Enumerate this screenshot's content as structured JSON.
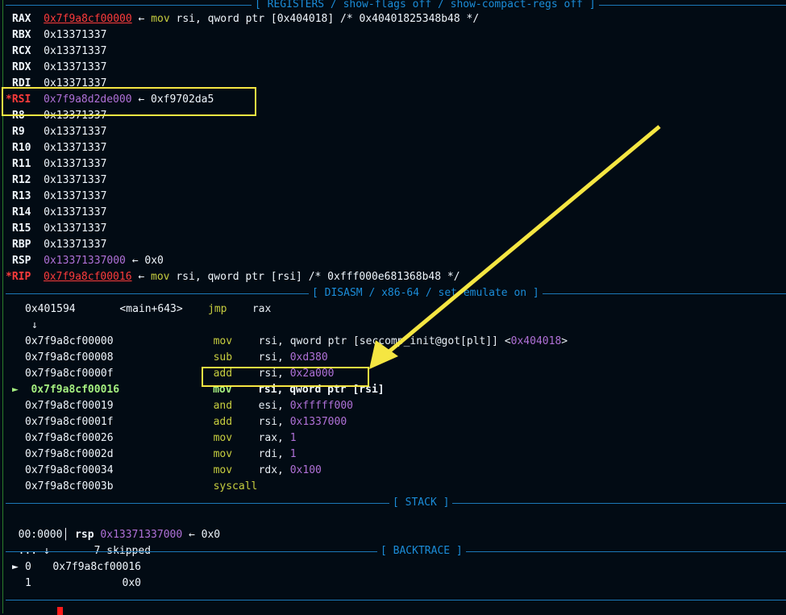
{
  "headers": {
    "registers": "[ REGISTERS / show-flags off / show-compact-regs off ]",
    "disasm": "[ DISASM / x86-64 / set emulate on ]",
    "stack": "[ STACK ]",
    "backtrace": "[ BACKTRACE ]"
  },
  "registers": [
    {
      "name": "RAX",
      "modified": false,
      "value": "0x7f9a8cf00000",
      "value_kind": "red-ptr",
      "deref": "mov rsi, qword ptr [0x404018] /* 0x40401825348b48 */"
    },
    {
      "name": "RBX",
      "modified": false,
      "value": "0x13371337"
    },
    {
      "name": "RCX",
      "modified": false,
      "value": "0x13371337"
    },
    {
      "name": "RDX",
      "modified": false,
      "value": "0x13371337"
    },
    {
      "name": "RDI",
      "modified": false,
      "value": "0x13371337"
    },
    {
      "name": "RSI",
      "modified": true,
      "value": "0x7f9a8d2de000",
      "value_kind": "ptr",
      "deref": "0xf9702da5"
    },
    {
      "name": "R8",
      "modified": false,
      "value": "0x13371337"
    },
    {
      "name": "R9",
      "modified": false,
      "value": "0x13371337"
    },
    {
      "name": "R10",
      "modified": false,
      "value": "0x13371337"
    },
    {
      "name": "R11",
      "modified": false,
      "value": "0x13371337"
    },
    {
      "name": "R12",
      "modified": false,
      "value": "0x13371337"
    },
    {
      "name": "R13",
      "modified": false,
      "value": "0x13371337"
    },
    {
      "name": "R14",
      "modified": false,
      "value": "0x13371337"
    },
    {
      "name": "R15",
      "modified": false,
      "value": "0x13371337"
    },
    {
      "name": "RBP",
      "modified": false,
      "value": "0x13371337"
    },
    {
      "name": "RSP",
      "modified": false,
      "value": "0x13371337000",
      "value_kind": "ptr",
      "deref": "0x0"
    },
    {
      "name": "RIP",
      "modified": true,
      "value": "0x7f9a8cf00016",
      "value_kind": "red-ptr",
      "deref": "mov rsi, qword ptr [rsi] /* 0xfff000e681368b48 */"
    }
  ],
  "disasm": {
    "first": {
      "addr": "0x401594",
      "sym": "<main+643>",
      "mnemonic": "jmp",
      "operands": "rax"
    },
    "down_arrow": "↓",
    "lines": [
      {
        "addr": "0x7f9a8cf00000",
        "mnemonic": "mov",
        "operands": "rsi, qword ptr [seccomp_init@got[plt]] <0x404018>"
      },
      {
        "addr": "0x7f9a8cf00008",
        "mnemonic": "sub",
        "operands": "rsi, 0xd380"
      },
      {
        "addr": "0x7f9a8cf0000f",
        "mnemonic": "add",
        "operands": "rsi, 0x2a000"
      },
      {
        "addr": "0x7f9a8cf00016",
        "mnemonic": "mov",
        "operands": "rsi, qword ptr [rsi]",
        "current": true
      },
      {
        "addr": "0x7f9a8cf00019",
        "mnemonic": "and",
        "operands": "esi, 0xfffff000"
      },
      {
        "addr": "0x7f9a8cf0001f",
        "mnemonic": "add",
        "operands": "rsi, 0x1337000"
      },
      {
        "addr": "0x7f9a8cf00026",
        "mnemonic": "mov",
        "operands": "rax, 1"
      },
      {
        "addr": "0x7f9a8cf0002d",
        "mnemonic": "mov",
        "operands": "rdi, 1"
      },
      {
        "addr": "0x7f9a8cf00034",
        "mnemonic": "mov",
        "operands": "rdx, 0x100"
      },
      {
        "addr": "0x7f9a8cf0003b",
        "mnemonic": "syscall",
        "operands": ""
      }
    ],
    "current_marker": "►"
  },
  "stack": {
    "offset": "00:0000",
    "reg": "rsp",
    "addr": "0x13371337000",
    "deref": "0x0",
    "skipped_prefix": "... ↓",
    "skipped_text": "7 skipped"
  },
  "backtrace": [
    {
      "marker": "►",
      "index": "0",
      "addr": "0x7f9a8cf00016"
    },
    {
      "marker": "",
      "index": "1",
      "addr": "0x0"
    }
  ],
  "annotation": {
    "color": "#f5e642"
  },
  "colors": {
    "background": "#020b14",
    "separator": "#1b78b8",
    "modified_register": "#ff3b3b",
    "pointer": "#b071d8",
    "mnemonic": "#c7ce3f",
    "current_instruction": "#a5f080"
  }
}
